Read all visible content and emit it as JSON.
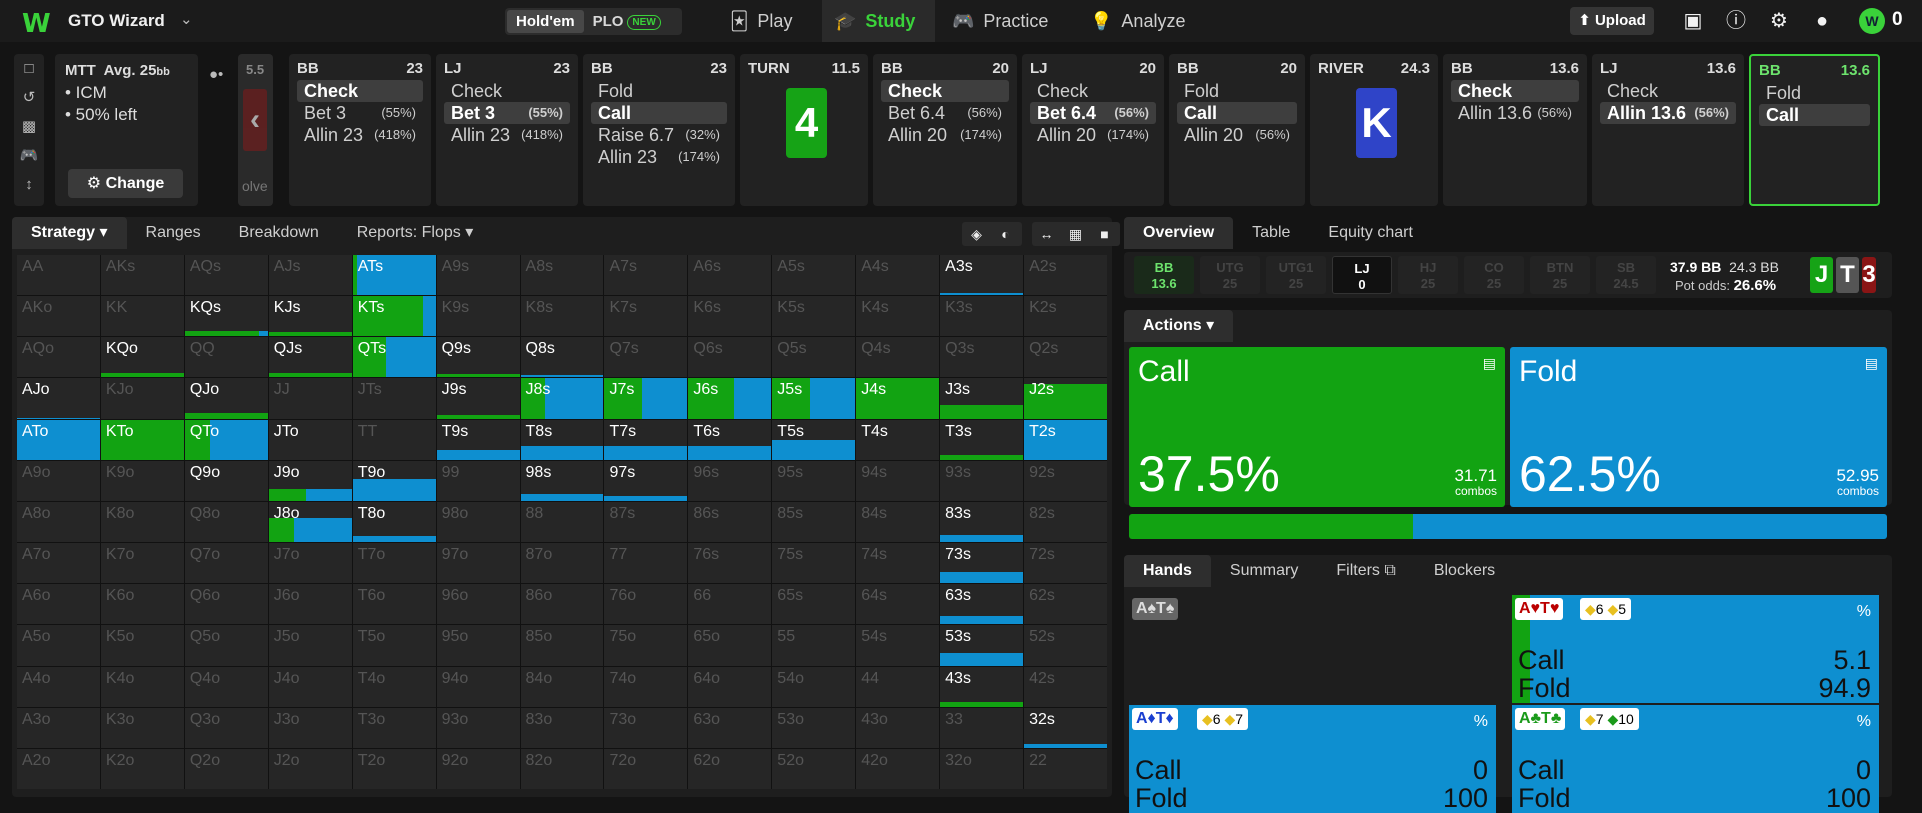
{
  "app": {
    "logo": "W",
    "name": "GTO Wizard"
  },
  "modes": [
    {
      "label": "Hold'em",
      "active": true
    },
    {
      "label": "PLO",
      "active": false,
      "badge": "NEW"
    }
  ],
  "nav": [
    {
      "label": "Play",
      "active": false
    },
    {
      "label": "Study",
      "active": true
    },
    {
      "label": "Practice",
      "active": false
    },
    {
      "label": "Analyze",
      "active": false
    }
  ],
  "toolbar": {
    "upload": "Upload",
    "coins": "0"
  },
  "spot": {
    "format": "MTT",
    "avg_label": "Avg. 25",
    "avg_unit": "bb",
    "bullets": [
      "• ICM",
      "• 50% left"
    ],
    "change": "Change"
  },
  "prev_card": {
    "num": "5.5",
    "text": "olve"
  },
  "nodes": [
    {
      "pos": "BB",
      "stack": "23",
      "rows": [
        {
          "a": "Check",
          "p": "",
          "sel": true
        },
        {
          "a": "Bet 3",
          "p": "(55%)",
          "sel": false
        },
        {
          "a": "Allin 23",
          "p": "(418%)",
          "sel": false
        }
      ]
    },
    {
      "pos": "LJ",
      "stack": "23",
      "rows": [
        {
          "a": "Check",
          "p": "",
          "sel": false
        },
        {
          "a": "Bet 3",
          "p": "(55%)",
          "sel": true
        },
        {
          "a": "Allin 23",
          "p": "(418%)",
          "sel": false
        }
      ]
    },
    {
      "pos": "BB",
      "stack": "23",
      "rows": [
        {
          "a": "Fold",
          "p": "",
          "sel": false
        },
        {
          "a": "Call",
          "p": "",
          "sel": true
        },
        {
          "a": "Raise 6.7",
          "p": "(32%)",
          "sel": false
        },
        {
          "a": "Allin 23",
          "p": "(174%)",
          "sel": false
        }
      ]
    },
    {
      "pos": "TURN",
      "stack": "11.5",
      "card": "4",
      "color": "#16a316"
    },
    {
      "pos": "BB",
      "stack": "20",
      "rows": [
        {
          "a": "Check",
          "p": "",
          "sel": true
        },
        {
          "a": "Bet 6.4",
          "p": "(56%)",
          "sel": false
        },
        {
          "a": "Allin 20",
          "p": "(174%)",
          "sel": false
        }
      ]
    },
    {
      "pos": "LJ",
      "stack": "20",
      "rows": [
        {
          "a": "Check",
          "p": "",
          "sel": false
        },
        {
          "a": "Bet 6.4",
          "p": "(56%)",
          "sel": true
        },
        {
          "a": "Allin 20",
          "p": "(174%)",
          "sel": false
        }
      ]
    },
    {
      "pos": "BB",
      "stack": "20",
      "rows": [
        {
          "a": "Fold",
          "p": "",
          "sel": false
        },
        {
          "a": "Call",
          "p": "",
          "sel": true
        },
        {
          "a": "Allin 20",
          "p": "(56%)",
          "sel": false
        }
      ]
    },
    {
      "pos": "RIVER",
      "stack": "24.3",
      "card": "K",
      "color": "#2f44c8"
    },
    {
      "pos": "BB",
      "stack": "13.6",
      "rows": [
        {
          "a": "Check",
          "p": "",
          "sel": true
        },
        {
          "a": "Allin 13.6",
          "p": "(56%)",
          "sel": false
        }
      ]
    },
    {
      "pos": "LJ",
      "stack": "13.6",
      "rows": [
        {
          "a": "Check",
          "p": "",
          "sel": false
        },
        {
          "a": "Allin 13.6",
          "p": "(56%)",
          "sel": true
        }
      ]
    },
    {
      "pos": "BB",
      "stack": "13.6",
      "current": true,
      "rows": [
        {
          "a": "Fold",
          "p": "",
          "sel": false
        },
        {
          "a": "Call",
          "p": "",
          "sel": true
        }
      ]
    }
  ],
  "left_tabs": [
    {
      "label": "Strategy",
      "active": true,
      "chev": true
    },
    {
      "label": "Ranges"
    },
    {
      "label": "Breakdown"
    },
    {
      "label": "Reports: Flops",
      "chev": true
    }
  ],
  "matrix": {
    "colors": {
      "call": "#12a312",
      "fold": "#0e8fd0",
      "empty": "#262626"
    },
    "rows": [
      [
        "AA",
        "AKs",
        "AQs",
        "AJs",
        "ATs",
        "A9s",
        "A8s",
        "A7s",
        "A6s",
        "A5s",
        "A4s",
        "A3s",
        "A2s"
      ],
      [
        "AKo",
        "KK",
        "KQs",
        "KJs",
        "KTs",
        "K9s",
        "K8s",
        "K7s",
        "K6s",
        "K5s",
        "K4s",
        "K3s",
        "K2s"
      ],
      [
        "AQo",
        "KQo",
        "QQ",
        "QJs",
        "QTs",
        "Q9s",
        "Q8s",
        "Q7s",
        "Q6s",
        "Q5s",
        "Q4s",
        "Q3s",
        "Q2s"
      ],
      [
        "AJo",
        "KJo",
        "QJo",
        "JJ",
        "JTs",
        "J9s",
        "J8s",
        "J7s",
        "J6s",
        "J5s",
        "J4s",
        "J3s",
        "J2s"
      ],
      [
        "ATo",
        "KTo",
        "QTo",
        "JTo",
        "TT",
        "T9s",
        "T8s",
        "T7s",
        "T6s",
        "T5s",
        "T4s",
        "T3s",
        "T2s"
      ],
      [
        "A9o",
        "K9o",
        "Q9o",
        "J9o",
        "T9o",
        "99",
        "98s",
        "97s",
        "96s",
        "95s",
        "94s",
        "93s",
        "92s"
      ],
      [
        "A8o",
        "K8o",
        "Q8o",
        "J8o",
        "T8o",
        "98o",
        "88",
        "87s",
        "86s",
        "85s",
        "84s",
        "83s",
        "82s"
      ],
      [
        "A7o",
        "K7o",
        "Q7o",
        "J7o",
        "T7o",
        "97o",
        "87o",
        "77",
        "76s",
        "75s",
        "74s",
        "73s",
        "72s"
      ],
      [
        "A6o",
        "K6o",
        "Q6o",
        "J6o",
        "T6o",
        "96o",
        "86o",
        "76o",
        "66",
        "65s",
        "64s",
        "63s",
        "62s"
      ],
      [
        "A5o",
        "K5o",
        "Q5o",
        "J5o",
        "T5o",
        "95o",
        "85o",
        "75o",
        "65o",
        "55",
        "54s",
        "53s",
        "52s"
      ],
      [
        "A4o",
        "K4o",
        "Q4o",
        "J4o",
        "T4o",
        "94o",
        "84o",
        "74o",
        "64o",
        "54o",
        "44",
        "43s",
        "42s"
      ],
      [
        "A3o",
        "K3o",
        "Q3o",
        "J3o",
        "T3o",
        "93o",
        "83o",
        "73o",
        "63o",
        "53o",
        "43o",
        "33",
        "32s"
      ],
      [
        "A2o",
        "K2o",
        "Q2o",
        "J2o",
        "T2o",
        "92o",
        "82o",
        "72o",
        "62o",
        "52o",
        "42o",
        "32o",
        "22"
      ]
    ],
    "strategies": {
      "ATs": {
        "h": 1,
        "c": 0.05
      },
      "A3s": {
        "h": 0.05,
        "c": 0
      },
      "KQs": {
        "h": 0.14,
        "c": 0.9
      },
      "KJs": {
        "h": 0.1,
        "c": 1
      },
      "KTs": {
        "h": 1,
        "c": 0.85
      },
      "KQo": {
        "h": 0.1,
        "c": 1
      },
      "QJs": {
        "h": 0.1,
        "c": 1
      },
      "QTs": {
        "h": 1,
        "c": 0.4
      },
      "Q9s": {
        "h": 0.08,
        "c": 1
      },
      "Q8s": {
        "h": 0.05,
        "c": 0
      },
      "AJo": {
        "h": 0.02,
        "c": 0
      },
      "QJo": {
        "h": 0.14,
        "c": 1
      },
      "J9s": {
        "h": 0.1,
        "c": 1
      },
      "J8s": {
        "h": 1,
        "c": 0.3
      },
      "J7s": {
        "h": 1,
        "c": 0.45
      },
      "J6s": {
        "h": 1,
        "c": 0.55
      },
      "J5s": {
        "h": 1,
        "c": 0.45
      },
      "J4s": {
        "h": 1,
        "c": 1
      },
      "J3s": {
        "h": 0.35,
        "c": 1
      },
      "J2s": {
        "h": 0.85,
        "c": 1
      },
      "ATo": {
        "h": 1,
        "c": 0
      },
      "KTo": {
        "h": 1,
        "c": 1
      },
      "QTo": {
        "h": 1,
        "c": 0.3
      },
      "T9s": {
        "h": 0.25,
        "c": 0
      },
      "T8s": {
        "h": 0.35,
        "c": 0
      },
      "T7s": {
        "h": 0.35,
        "c": 0
      },
      "T6s": {
        "h": 0.35,
        "c": 0
      },
      "T5s": {
        "h": 0.5,
        "c": 0
      },
      "T3s": {
        "h": 0.12,
        "c": 1
      },
      "T2s": {
        "h": 1,
        "c": 0
      },
      "J9o": {
        "h": 0.3,
        "c": 0.45
      },
      "T9o": {
        "h": 0.55,
        "c": 0
      },
      "98s": {
        "h": 0.18,
        "c": 0
      },
      "97s": {
        "h": 0.12,
        "c": 0
      },
      "J8o": {
        "h": 0.6,
        "c": 0.3
      },
      "T8o": {
        "h": 0.16,
        "c": 0
      },
      "83s": {
        "h": 0.18,
        "c": 0
      },
      "73s": {
        "h": 0.28,
        "c": 0
      },
      "63s": {
        "h": 0.2,
        "c": 0
      },
      "53s": {
        "h": 0.3,
        "c": 0
      },
      "43s": {
        "h": 0.12,
        "c": 1
      },
      "32s": {
        "h": 0.1,
        "c": 0
      }
    },
    "bright": [
      "A3s",
      "KQs",
      "KJs",
      "KTs",
      "KQo",
      "QJs",
      "QTs",
      "Q9s",
      "Q8s",
      "AJo",
      "QJo",
      "J9s",
      "J8s",
      "J7s",
      "J6s",
      "J5s",
      "J4s",
      "J3s",
      "J2s",
      "ATo",
      "KTo",
      "QTo",
      "JTo",
      "T9s",
      "T8s",
      "T7s",
      "T6s",
      "T5s",
      "T4s",
      "T3s",
      "T2s",
      "Q9o",
      "J9o",
      "T9o",
      "98s",
      "97s",
      "J8o",
      "T8o",
      "83s",
      "73s",
      "63s",
      "53s",
      "43s",
      "32s",
      "ATs"
    ]
  },
  "right_tabs": [
    {
      "label": "Overview",
      "active": true
    },
    {
      "label": "Table"
    },
    {
      "label": "Equity chart"
    }
  ],
  "seats": [
    {
      "pos": "BB",
      "stack": "13.6",
      "cls": "bb"
    },
    {
      "pos": "UTG",
      "stack": "25"
    },
    {
      "pos": "UTG1",
      "stack": "25"
    },
    {
      "pos": "LJ",
      "stack": "0",
      "cls": "lj"
    },
    {
      "pos": "HJ",
      "stack": "25"
    },
    {
      "pos": "CO",
      "stack": "25"
    },
    {
      "pos": "BTN",
      "stack": "25"
    },
    {
      "pos": "SB",
      "stack": "24.5"
    }
  ],
  "pot": {
    "pot": "37.9 BB",
    "to_call": "24.3 BB",
    "odds_label": "Pot odds:",
    "odds": "26.6%"
  },
  "board": [
    {
      "r": "J",
      "c": "#16a316"
    },
    {
      "r": "T",
      "c": "#555555"
    },
    {
      "r": "3",
      "c": "#8a1515"
    }
  ],
  "actions": {
    "header": "Actions",
    "items": [
      {
        "name": "Call",
        "pct": "37.5%",
        "combos": "31.71",
        "unit": "combos",
        "color": "#12a312"
      },
      {
        "name": "Fold",
        "pct": "62.5%",
        "combos": "52.95",
        "unit": "combos",
        "color": "#0e8fd0"
      }
    ],
    "freq": [
      0.375,
      0.625
    ]
  },
  "hand_tabs": [
    {
      "label": "Hands",
      "active": true
    },
    {
      "label": "Summary"
    },
    {
      "label": "Filters"
    },
    {
      "label": "Blockers"
    }
  ],
  "hands": [
    {
      "combo": "A♠T♠",
      "combo_color": "#ddd",
      "bg": "#666",
      "blk": [],
      "pct": "",
      "lines": [],
      "fill": 0
    },
    {
      "combo": "A♥T♥",
      "combo_color": "#b00",
      "blk": [
        {
          "t": "6",
          "c": "#e8c020"
        },
        {
          "t": "5",
          "c": "#e8c020"
        }
      ],
      "pct": "%",
      "lines": [
        {
          "a": "Call",
          "v": "5.1"
        },
        {
          "a": "Fold",
          "v": "94.9"
        }
      ],
      "fill": 1,
      "call": 0.05
    },
    {
      "combo": "A♦T♦",
      "combo_color": "#1a3fd0",
      "blk": [
        {
          "t": "6",
          "c": "#e8c020"
        },
        {
          "t": "7",
          "c": "#e8c020"
        }
      ],
      "pct": "%",
      "lines": [
        {
          "a": "Call",
          "v": "0"
        },
        {
          "a": "Fold",
          "v": "100"
        }
      ],
      "fill": 1,
      "call": 0
    },
    {
      "combo": "A♣T♣",
      "combo_color": "#1a9a1a",
      "blk": [
        {
          "t": "7",
          "c": "#e8c020"
        },
        {
          "t": "10",
          "c": "#1a9a1a"
        }
      ],
      "pct": "%",
      "lines": [
        {
          "a": "Call",
          "v": "0"
        },
        {
          "a": "Fold",
          "v": "100"
        }
      ],
      "fill": 1,
      "call": 0
    }
  ]
}
